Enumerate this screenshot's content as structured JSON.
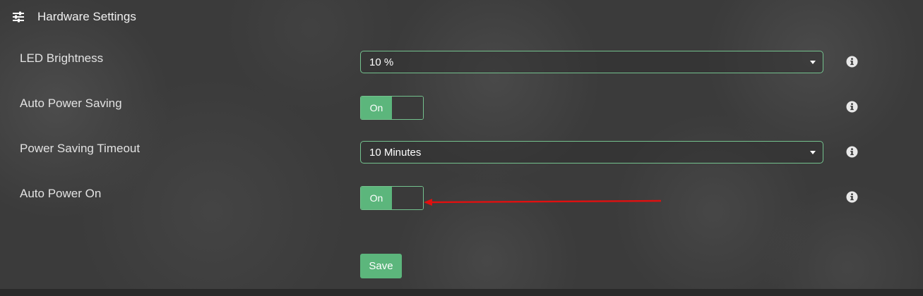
{
  "header": {
    "icon": "sliders-icon",
    "title": "Hardware Settings"
  },
  "settings": [
    {
      "label": "LED Brightness",
      "type": "select",
      "value": "10 %",
      "info_icon": "info-icon"
    },
    {
      "label": "Auto Power Saving",
      "type": "toggle",
      "value": "On",
      "info_icon": "info-icon"
    },
    {
      "label": "Power Saving Timeout",
      "type": "select",
      "value": "10 Minutes",
      "info_icon": "info-icon"
    },
    {
      "label": "Auto Power On",
      "type": "toggle",
      "value": "On",
      "info_icon": "info-icon"
    }
  ],
  "save_label": "Save",
  "colors": {
    "accent": "#5cb67c",
    "border_accent": "#74c28e",
    "background": "#3b3b3b",
    "annotation": "#e01010"
  }
}
